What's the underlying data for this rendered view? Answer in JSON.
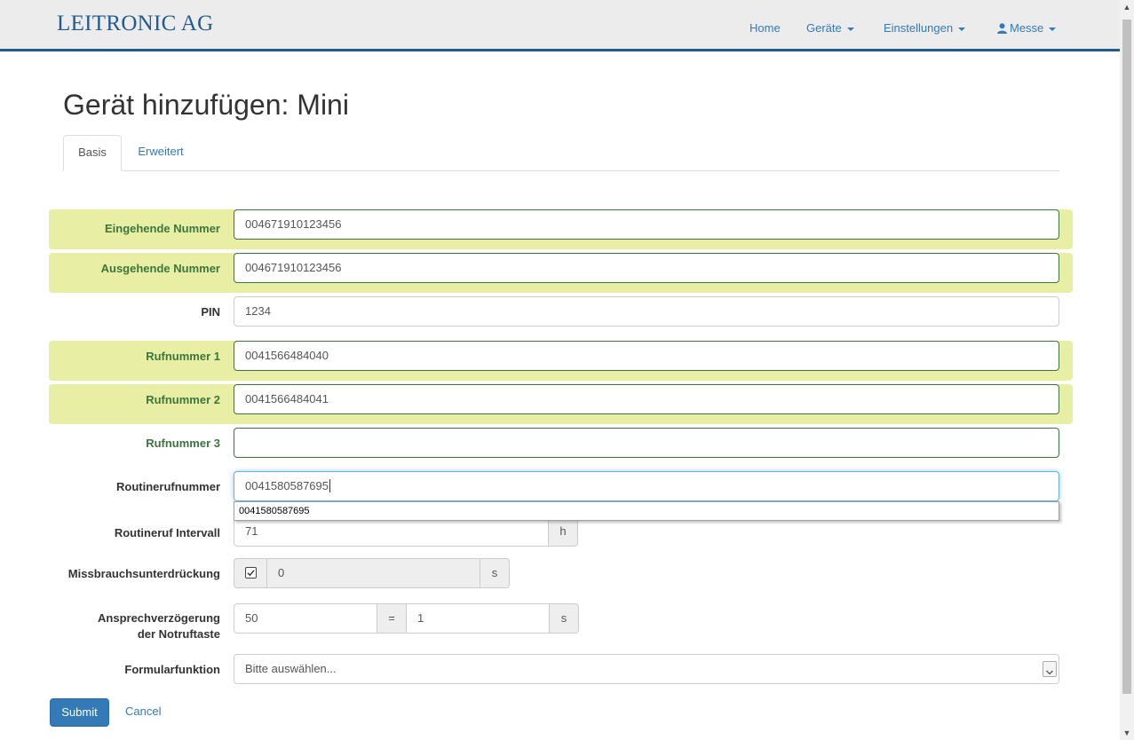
{
  "navbar": {
    "brand": "LEITRONIC AG",
    "home": "Home",
    "devices": "Geräte",
    "settings": "Einstellungen",
    "user": "Messe",
    "accent_color": "#235a8f"
  },
  "page": {
    "title": "Gerät hinzufügen: Mini"
  },
  "tabs": [
    {
      "label": "Basis",
      "active": true
    },
    {
      "label": "Erweitert",
      "active": false
    }
  ],
  "form": {
    "incoming": {
      "label": "Eingehende Nummer",
      "value": "004671910123456"
    },
    "outgoing": {
      "label": "Ausgehende Nummer",
      "value": "004671910123456"
    },
    "pin": {
      "label": "PIN",
      "value": "1234"
    },
    "phone1": {
      "label": "Rufnummer 1",
      "value": "0041566484040"
    },
    "phone2": {
      "label": "Rufnummer 2",
      "value": "0041566484041"
    },
    "phone3": {
      "label": "Rufnummer 3",
      "value": ""
    },
    "routine_number": {
      "label": "Routinerufnummer",
      "value": "0041580587695",
      "suggestion": "0041580587695"
    },
    "routine_interval": {
      "label": "Routineruf Intervall",
      "value": "71",
      "unit": "h"
    },
    "abuse": {
      "label": "Missbrauchsunterdrückung",
      "checked": true,
      "value": "0",
      "unit": "s"
    },
    "response_delay": {
      "label_line1": "Ansprechverzögerung",
      "label_line2": "der Notruftaste",
      "value": "50",
      "equals": "=",
      "value2": "1",
      "unit": "s"
    },
    "form_function": {
      "label": "Formularfunktion",
      "placeholder": "Bitte auswählen..."
    }
  },
  "actions": {
    "submit": "Submit",
    "cancel": "Cancel"
  },
  "colors": {
    "highlight_row": "#e8efa4",
    "success": "#3c763d",
    "primary": "#337ab7"
  }
}
